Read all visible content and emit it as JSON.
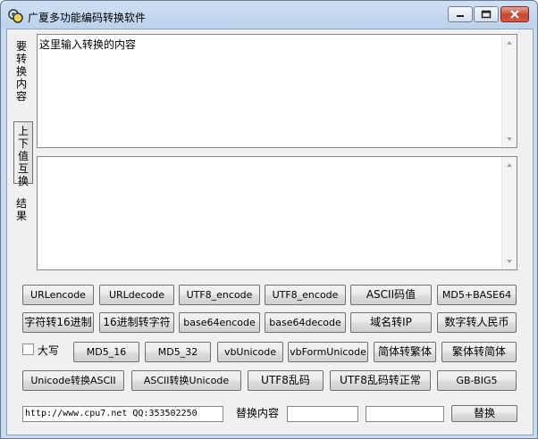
{
  "window": {
    "title": "广夏多功能编码转换软件"
  },
  "labels": {
    "input_side": "要转换内容",
    "result_side": "结果",
    "swap_button": "上下值互换"
  },
  "input": {
    "value": "这里输入转换的内容"
  },
  "result": {
    "value": ""
  },
  "buttons": {
    "row1": [
      "URLencode",
      "URLdecode",
      "UTF8_encode",
      "UTF8_encode",
      "ASCII码值",
      "MD5+BASE64"
    ],
    "row2": [
      "字符转16进制",
      "16进制转字符",
      "base64encode",
      "base64decode",
      "域名转IP",
      "数字转人民币"
    ],
    "row3": [
      "MD5_16",
      "MD5_32",
      "vbUnicode",
      "vbFormUnicode",
      "简体转繁体",
      "繁体转简体"
    ],
    "row4": [
      "Unicode转换ASCII",
      "ASCII转换Unicode",
      "UTF8乱码",
      "UTF8乱码转正常",
      "GB-BIG5"
    ]
  },
  "uppercase": {
    "label": "大写",
    "checked": false
  },
  "footer": {
    "url_text": "http://www.cpu7.net QQ:353502250",
    "replace_label": "替换内容",
    "replace_from": "",
    "replace_to": "",
    "replace_button": "替换"
  },
  "icons": {
    "app": "app-logo-icon",
    "minimize": "minimize-icon",
    "maximize": "maximize-icon",
    "close": "close-icon",
    "scroll_up": "scroll-up-arrow-icon",
    "scroll_down": "scroll-down-arrow-icon"
  },
  "colors": {
    "titlebar": "#c8dcf2",
    "close": "#c8452c",
    "client": "#f0f0f0"
  }
}
